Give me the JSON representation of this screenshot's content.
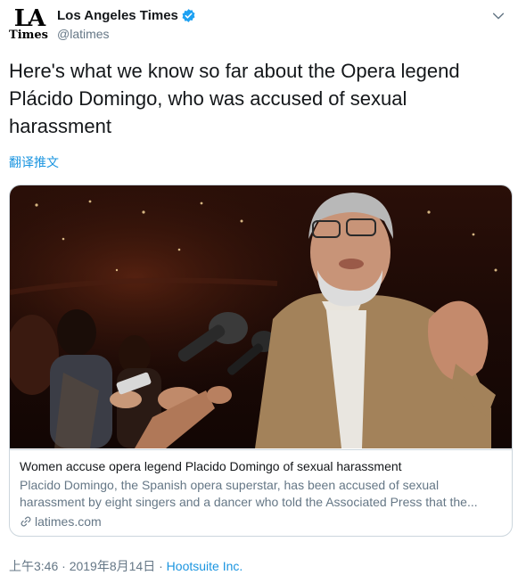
{
  "account": {
    "display_name": "Los Angeles Times",
    "handle": "@latimes",
    "avatar_line1": "LA",
    "avatar_line2": "Times"
  },
  "tweet": {
    "text": "Here's what we know so far about the Opera legend Plácido Domingo, who was accused of sexual harassment",
    "translate_label": "翻译推文"
  },
  "card": {
    "title": "Women accuse opera legend Placido Domingo of sexual harassment",
    "description": "Placido Domingo, the Spanish opera superstar, has been accused of sexual harassment by eight singers and a dancer who told the Associated Press that the...",
    "domain": "latimes.com"
  },
  "meta": {
    "time": "上午3:46",
    "separator": "·",
    "date": "2019年8月14日",
    "source": "Hootsuite Inc."
  },
  "colors": {
    "link": "#1b95e0",
    "secondary_text": "#657786",
    "border": "#ccd6dd",
    "verified": "#1da1f2"
  },
  "icons": [
    "chevron-down-icon",
    "verified-badge-icon",
    "link-icon"
  ]
}
